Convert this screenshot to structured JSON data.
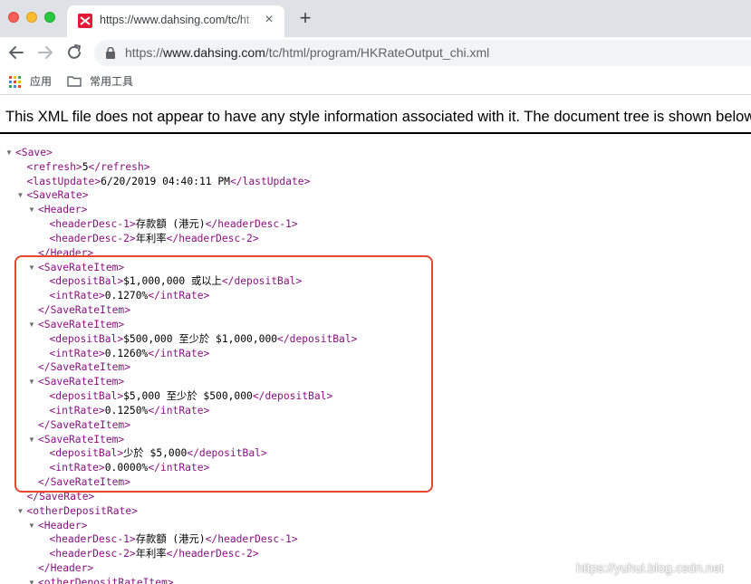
{
  "browser": {
    "tab": {
      "title": "https://www.dahsing.com/tc/ht",
      "close_label": "×"
    },
    "new_tab_label": "+",
    "address": {
      "scheme": "https://",
      "host": "www.dahsing.com",
      "path": "/tc/html/program/HKRateOutput_chi.xml"
    },
    "bookmarks": [
      {
        "label": "应用",
        "icon": "apps-grid-icon"
      },
      {
        "label": "常用工具",
        "icon": "folder-icon"
      }
    ]
  },
  "notice": "This XML file does not appear to have any style information associated with it. The document tree is shown below.",
  "xml_lines": [
    {
      "indent": 0,
      "toggle": true,
      "open": "<Save>",
      "text": "",
      "close": ""
    },
    {
      "indent": 1,
      "toggle": false,
      "open": "<refresh>",
      "text": "5",
      "close": "</refresh>"
    },
    {
      "indent": 1,
      "toggle": false,
      "open": "<lastUpdate>",
      "text": "6/20/2019 04:40:11 PM",
      "close": "</lastUpdate>"
    },
    {
      "indent": 1,
      "toggle": true,
      "open": "<SaveRate>",
      "text": "",
      "close": ""
    },
    {
      "indent": 2,
      "toggle": true,
      "open": "<Header>",
      "text": "",
      "close": ""
    },
    {
      "indent": 3,
      "toggle": false,
      "open": "<headerDesc-1>",
      "text": "存款額 (港元)",
      "close": "</headerDesc-1>"
    },
    {
      "indent": 3,
      "toggle": false,
      "open": "<headerDesc-2>",
      "text": "年利率",
      "close": "</headerDesc-2>"
    },
    {
      "indent": 2,
      "toggle": false,
      "open": "",
      "text": "",
      "close": "</Header>"
    },
    {
      "indent": 2,
      "toggle": true,
      "open": "<SaveRateItem>",
      "text": "",
      "close": ""
    },
    {
      "indent": 3,
      "toggle": false,
      "open": "<depositBal>",
      "text": "$1,000,000 或以上",
      "close": "</depositBal>"
    },
    {
      "indent": 3,
      "toggle": false,
      "open": "<intRate>",
      "text": "0.1270%",
      "close": "</intRate>"
    },
    {
      "indent": 2,
      "toggle": false,
      "open": "",
      "text": "",
      "close": "</SaveRateItem>"
    },
    {
      "indent": 2,
      "toggle": true,
      "open": "<SaveRateItem>",
      "text": "",
      "close": ""
    },
    {
      "indent": 3,
      "toggle": false,
      "open": "<depositBal>",
      "text": "$500,000 至少於 $1,000,000",
      "close": "</depositBal>"
    },
    {
      "indent": 3,
      "toggle": false,
      "open": "<intRate>",
      "text": "0.1260%",
      "close": "</intRate>"
    },
    {
      "indent": 2,
      "toggle": false,
      "open": "",
      "text": "",
      "close": "</SaveRateItem>"
    },
    {
      "indent": 2,
      "toggle": true,
      "open": "<SaveRateItem>",
      "text": "",
      "close": ""
    },
    {
      "indent": 3,
      "toggle": false,
      "open": "<depositBal>",
      "text": "$5,000 至少於 $500,000",
      "close": "</depositBal>"
    },
    {
      "indent": 3,
      "toggle": false,
      "open": "<intRate>",
      "text": "0.1250%",
      "close": "</intRate>"
    },
    {
      "indent": 2,
      "toggle": false,
      "open": "",
      "text": "",
      "close": "</SaveRateItem>"
    },
    {
      "indent": 2,
      "toggle": true,
      "open": "<SaveRateItem>",
      "text": "",
      "close": ""
    },
    {
      "indent": 3,
      "toggle": false,
      "open": "<depositBal>",
      "text": "少於 $5,000",
      "close": "</depositBal>"
    },
    {
      "indent": 3,
      "toggle": false,
      "open": "<intRate>",
      "text": "0.0000%",
      "close": "</intRate>"
    },
    {
      "indent": 2,
      "toggle": false,
      "open": "",
      "text": "",
      "close": "</SaveRateItem>"
    },
    {
      "indent": 1,
      "toggle": false,
      "open": "",
      "text": "",
      "close": "</SaveRate>"
    },
    {
      "indent": 1,
      "toggle": true,
      "open": "<otherDepositRate>",
      "text": "",
      "close": ""
    },
    {
      "indent": 2,
      "toggle": true,
      "open": "<Header>",
      "text": "",
      "close": ""
    },
    {
      "indent": 3,
      "toggle": false,
      "open": "<headerDesc-1>",
      "text": "存款額 (港元)",
      "close": "</headerDesc-1>"
    },
    {
      "indent": 3,
      "toggle": false,
      "open": "<headerDesc-2>",
      "text": "年利率",
      "close": "</headerDesc-2>"
    },
    {
      "indent": 2,
      "toggle": false,
      "open": "",
      "text": "",
      "close": "</Header>"
    },
    {
      "indent": 2,
      "toggle": true,
      "open": "<otherDepositRateItem>",
      "text": "",
      "close": ""
    }
  ],
  "annotation": {
    "color": "#e8462f"
  },
  "watermark": "https://yuhui.blog.csdn.net",
  "colors": {
    "tag": "#881280",
    "text": "#000000",
    "chrome_bg": "#dee1e6",
    "omnibox_bg": "#f1f3f4"
  }
}
